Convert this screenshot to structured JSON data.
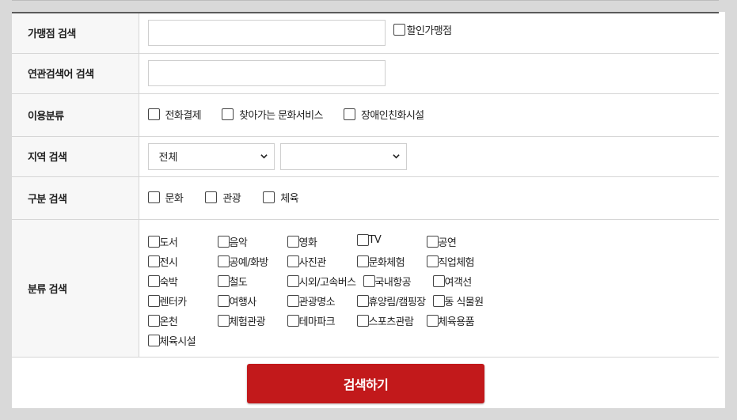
{
  "form": {
    "store_search": {
      "label": "가맹점 검색",
      "value": "",
      "discount_label": "할인가맹점"
    },
    "related_search": {
      "label": "연관검색어 검색",
      "value": ""
    },
    "usage": {
      "label": "이용분류",
      "options": [
        "전화결제",
        "찾아가는 문화서비스",
        "장애인친화시설"
      ]
    },
    "region": {
      "label": "지역 검색",
      "select1_value": "전체",
      "select2_value": ""
    },
    "division": {
      "label": "구분 검색",
      "options": [
        "문화",
        "관광",
        "체육"
      ]
    },
    "category": {
      "label": "분류 검색",
      "rows": [
        [
          "도서",
          "음악",
          "영화",
          "TV",
          "공연"
        ],
        [
          "전시",
          "공예/화방",
          "사진관",
          "문화체험",
          "직업체험"
        ],
        [
          "숙박",
          "철도",
          "시외/고속버스",
          "국내항공",
          "여객선"
        ],
        [
          "렌터카",
          "여행사",
          "관광명소",
          "휴양림/캠핑장",
          "동 식물원"
        ],
        [
          "온천",
          "체험관광",
          "테마파크",
          "스포츠관람",
          "체육용품"
        ],
        [
          "체육시설"
        ]
      ]
    }
  },
  "search_button": "검색하기",
  "colors": {
    "button": "#c2191b",
    "header_bg": "#f7f7f7",
    "page_bg": "#d9d9d9"
  }
}
